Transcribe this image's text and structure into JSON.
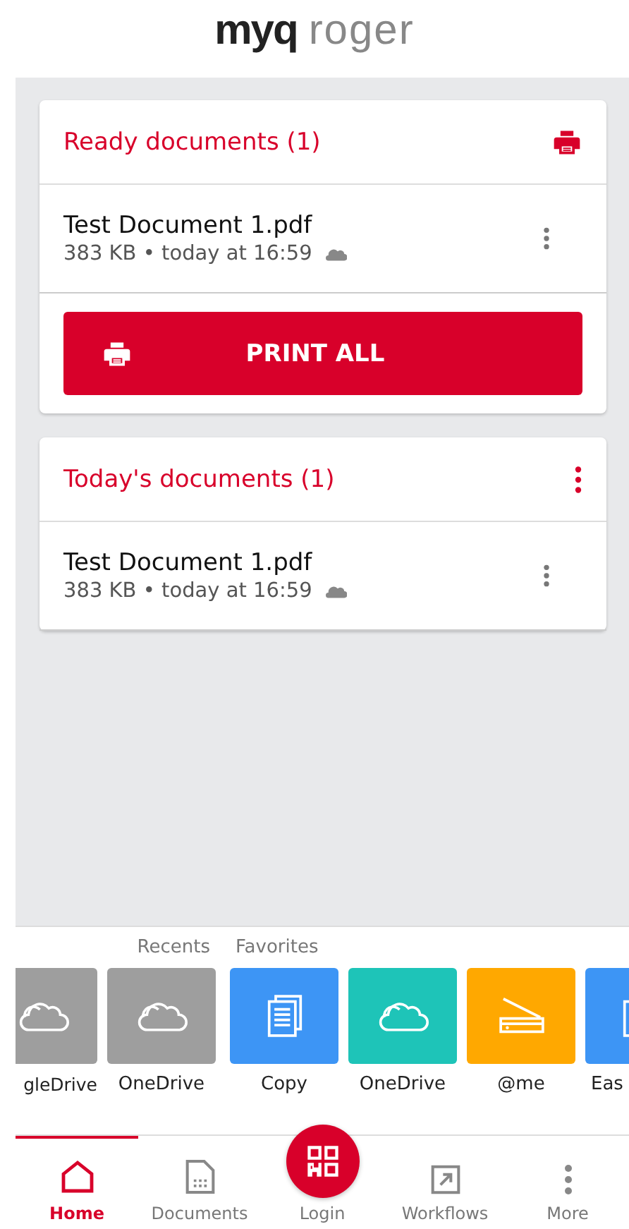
{
  "logo": {
    "brand": "myq",
    "product": "roger"
  },
  "sections": [
    {
      "title": "Ready documents (1)",
      "kind": "printer",
      "documents": [
        {
          "name": "Test Document 1.pdf",
          "meta": "383 KB • today at 16:59"
        }
      ],
      "button": "PRINT ALL"
    },
    {
      "title": "Today's documents (1)",
      "kind": "menu",
      "documents": [
        {
          "name": "Test Document 1.pdf",
          "meta": "383 KB • today at 16:59"
        }
      ]
    }
  ],
  "shortcuts": [
    {
      "label": "Recents",
      "items": [
        {
          "label": "gleDrive",
          "kind": "cloud",
          "color": "#9e9e9e"
        },
        {
          "label": "OneDrive",
          "kind": "cloud",
          "color": "#9e9e9e"
        }
      ]
    },
    {
      "label": "Favorites",
      "items": [
        {
          "label": "Copy",
          "kind": "document",
          "color": "#3d95f5"
        },
        {
          "label": "OneDrive",
          "kind": "cloud",
          "color": "#1ec4b8"
        },
        {
          "label": "@me",
          "kind": "scanner",
          "color": "#ffa800"
        },
        {
          "label": "Eas",
          "kind": "document",
          "color": "#3d95f5"
        }
      ]
    }
  ],
  "nav": [
    {
      "label": "Home",
      "kind": "home",
      "selected": true
    },
    {
      "label": "Documents",
      "kind": "documents",
      "selected": false
    },
    {
      "label": "Login",
      "kind": "qr",
      "selected": false
    },
    {
      "label": "Workflows",
      "kind": "workflow",
      "selected": false
    },
    {
      "label": "More",
      "kind": "more",
      "selected": false
    }
  ]
}
